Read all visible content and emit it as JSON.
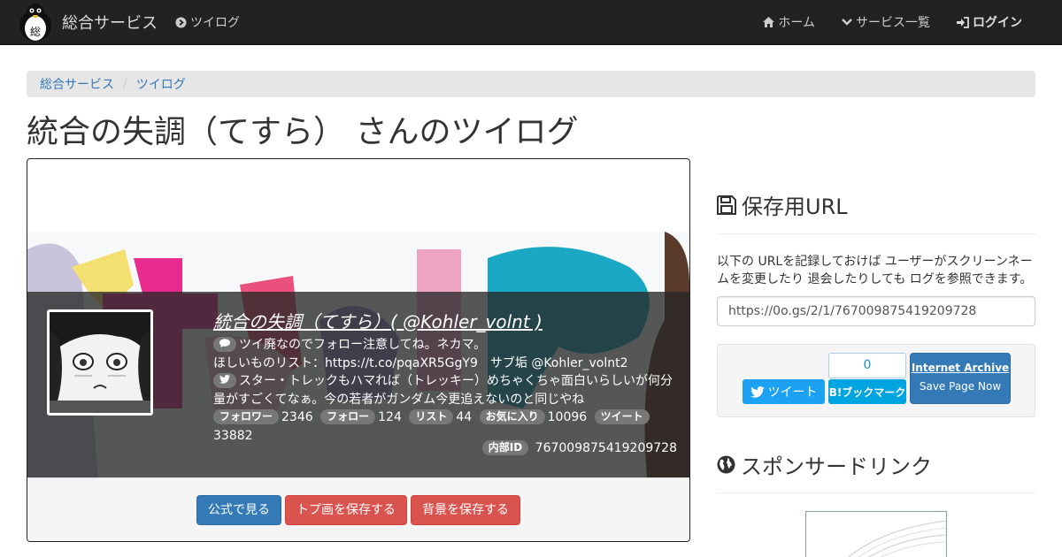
{
  "navbar": {
    "brand": "総合サービス",
    "section_link": "ツイログ",
    "items": [
      {
        "label": "ホーム",
        "icon": "home-icon"
      },
      {
        "label": "サービス一覧",
        "icon": "chevron-down-icon"
      },
      {
        "label": "ログイン",
        "icon": "sign-in-icon"
      }
    ]
  },
  "breadcrumb": [
    "総合サービス",
    "ツイログ"
  ],
  "page_title": "統合の失調（てすら） さんのツイログ",
  "profile": {
    "name": "統合の失調（てすら）( @Kohler_volnt )",
    "bio_line1": "ツイ廃なのでフォロー注意してね。ネカマ。",
    "bio_line2": "ほしいものリスト：https://t.co/pqaXR5GgY9　サブ垢 @Kohler_volnt2",
    "latest_tweet": "スター・トレックもハマれば（トレッキー）めちゃくちゃ面白いらしいが何分量がすごくてなぁ。今の若者がガンダム今更追えないのと同じやね",
    "stats": [
      {
        "label": "フォロワー",
        "value": "2346"
      },
      {
        "label": "フォロー",
        "value": "124"
      },
      {
        "label": "リスト",
        "value": "44"
      },
      {
        "label": "お気に入り",
        "value": "10096"
      },
      {
        "label": "ツイート",
        "value": "33882"
      }
    ],
    "internal_id_label": "内部ID",
    "internal_id": "767009875419209728"
  },
  "card_buttons": {
    "official": "公式で見る",
    "save_avatar": "トプ画を保存する",
    "save_banner": "背景を保存する"
  },
  "save_url": {
    "heading": "保存用URL",
    "description": "以下の URLを記録しておけば ユーザーがスクリーンネームを変更したり 退会したりしても ログを参照できます。",
    "url": "https://0o.gs/2/1/767009875419209728"
  },
  "share": {
    "tweet_label": "ツイート",
    "hatena_count": "0",
    "hatena_label": "B!ブックマーク",
    "ia_title": "Internet Archive",
    "ia_sub": "Save Page Now"
  },
  "sponsored": {
    "heading": "スポンサードリンク"
  },
  "colors": {
    "navbar": "#222222",
    "primary": "#337ab7",
    "danger": "#d9534f",
    "twitter": "#1da1f2",
    "hatena": "#00a4de"
  }
}
